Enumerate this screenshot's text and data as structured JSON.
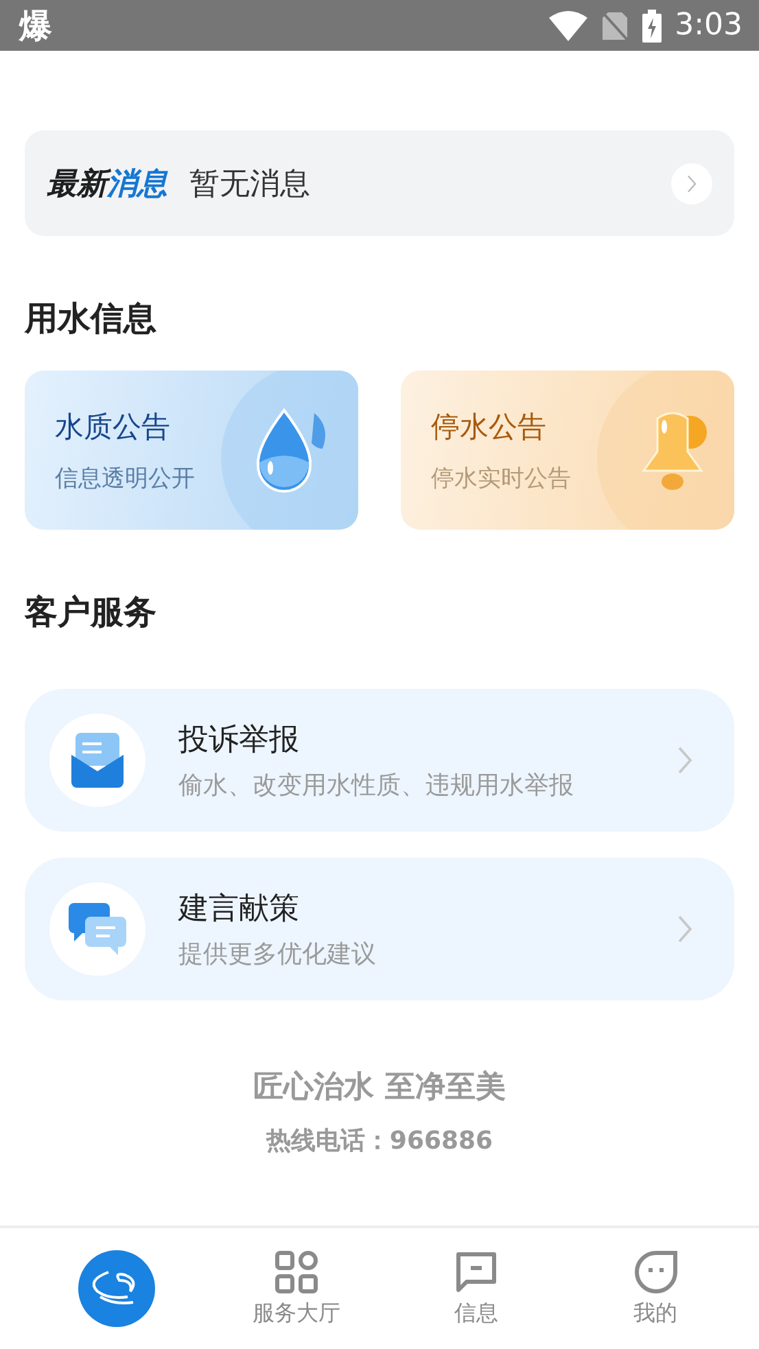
{
  "status_bar": {
    "app_glyph": "爆",
    "time": "3:03"
  },
  "news_bar": {
    "title_part_1": "最新",
    "title_part_2": "消息",
    "text": "暂无消息"
  },
  "water_info": {
    "heading": "用水信息",
    "cards": [
      {
        "kind": "drop",
        "title": "水质公告",
        "subtitle": "信息透明公开"
      },
      {
        "kind": "bell",
        "title": "停水公告",
        "subtitle": "停水实时公告"
      }
    ]
  },
  "customer_service": {
    "heading": "客户服务",
    "items": [
      {
        "kind": "mail",
        "title": "投诉举报",
        "subtitle": "偷水、改变用水性质、违规用水举报"
      },
      {
        "kind": "chat",
        "title": "建言献策",
        "subtitle": "提供更多优化建议"
      }
    ]
  },
  "footer": {
    "slogan": "匠心治水 至净至美",
    "hotline": "热线电话：966886"
  },
  "bottom_nav": [
    {
      "kind": "logo",
      "selected": true
    },
    {
      "kind": "grid",
      "label": "服务大厅",
      "selected": false
    },
    {
      "kind": "message",
      "label": "信息",
      "selected": false
    },
    {
      "kind": "face",
      "label": "我的",
      "selected": false
    }
  ]
}
